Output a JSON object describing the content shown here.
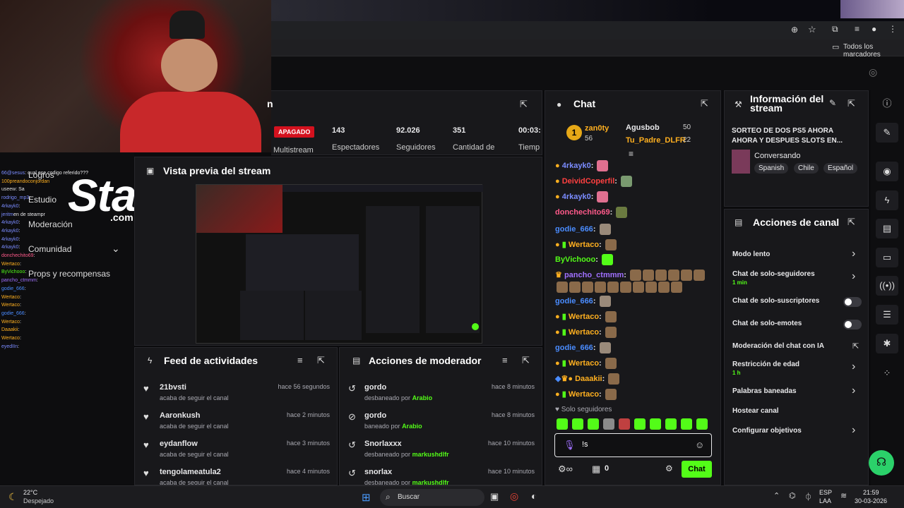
{
  "browser": {
    "bookmarks_label": "Todos los marcadores"
  },
  "overlay": {
    "logo": "Stake",
    "logo_sub": ".com",
    "menu": [
      {
        "label": "Logros"
      },
      {
        "label": "Estudio"
      },
      {
        "label": "Moderación"
      },
      {
        "label": "Comunidad"
      },
      {
        "label": "Props y recompensas"
      }
    ],
    "side_chat": [
      {
        "user": "66@sesus",
        "text": ": cual ese codigo referido???"
      },
      {
        "user": "100preandoconjordan",
        "text": ""
      },
      {
        "user": "useew",
        "text": ": Sa"
      },
      {
        "user": "rodrigo_mp3",
        "text": ":"
      },
      {
        "user": "4rkayk0",
        "text": ":"
      },
      {
        "user": "jeritm",
        "text": "en de steampr"
      },
      {
        "user": "4rkayk0",
        "text": ":"
      },
      {
        "user": "4rkayk0",
        "text": ":"
      },
      {
        "user": "4rkayk0",
        "text": ":"
      },
      {
        "user": "4rkayk0",
        "text": ":"
      },
      {
        "user": "donchechito69",
        "text": ":"
      },
      {
        "user": "Wertaco",
        "text": ":"
      },
      {
        "user": "ByVichooo",
        "text": ":"
      },
      {
        "user": "pancho_ctmmm",
        "text": ":"
      },
      {
        "user": "godie_666",
        "text": ":"
      },
      {
        "user": "Wertaco",
        "text": ":"
      },
      {
        "user": "Wertaco",
        "text": ":"
      },
      {
        "user": "godie_666",
        "text": ":"
      },
      {
        "user": "Wertaco",
        "text": ":"
      },
      {
        "user": "Daaakii",
        "text": ":"
      },
      {
        "user": "Wertaco",
        "text": ":"
      },
      {
        "user": "eyedIIn",
        "text": ":"
      }
    ]
  },
  "stats": {
    "status": "APAGADO",
    "multistream": "Multistream",
    "spectators_value": "143",
    "spectators_label": "Espectadores",
    "followers_value": "92.026",
    "followers_label": "Seguidores",
    "amount_value": "351",
    "amount_label": "Cantidad de",
    "time_value": "00:03:",
    "time_label": "Tiemp"
  },
  "preview": {
    "title": "Vista previa del stream"
  },
  "activity": {
    "title": "Feed de actividades",
    "items": [
      {
        "user": "21bvsti",
        "action": "acaba de seguir el canal",
        "time": "hace 56 segundos"
      },
      {
        "user": "Aaronkush",
        "action": "acaba de seguir el canal",
        "time": "hace 2 minutos"
      },
      {
        "user": "eydanflow",
        "action": "acaba de seguir el canal",
        "time": "hace 3 minutos"
      },
      {
        "user": "tengolameatula2",
        "action": "acaba de seguir el canal",
        "time": "hace 4 minutos"
      }
    ]
  },
  "modactions": {
    "title": "Acciones de moderador",
    "items": [
      {
        "user": "gordo",
        "action": "desbaneado por",
        "by": "Arabio",
        "time": "hace 8 minutos"
      },
      {
        "user": "gordo",
        "action": "baneado por",
        "by": "Arabio",
        "time": "hace 8 minutos"
      },
      {
        "user": "Snorlaxxx",
        "action": "desbaneado por",
        "by": "markushdlfr",
        "time": "hace 10 minutos"
      },
      {
        "user": "snorlax",
        "action": "desbaneado por",
        "by": "markushdlfr",
        "time": "hace 10 minutos"
      }
    ]
  },
  "chat": {
    "title": "Chat",
    "top": [
      {
        "rank": "1",
        "user": "zan0ty",
        "amount": "56"
      },
      {
        "rank": "",
        "user": "Agusbob",
        "amount": "50"
      },
      {
        "rank": "",
        "user": "Tu_Padre_DLFR",
        "amount": "22"
      }
    ],
    "messages": [
      {
        "user": "4rkayk0",
        "color": "#7b8cff"
      },
      {
        "user": "DeividCoperfil",
        "color": "#ff4040"
      },
      {
        "user": "4rkayk0",
        "color": "#7b8cff"
      },
      {
        "user": "donchechito69",
        "color": "#ff5a8a"
      },
      {
        "user": "godie_666",
        "color": "#4a8cff"
      },
      {
        "user": "Wertaco",
        "color": "#ffb020"
      },
      {
        "user": "ByVichooo",
        "color": "#53fc18"
      },
      {
        "user": "pancho_ctmmm",
        "color": "#a070ff"
      },
      {
        "user": "godie_666",
        "color": "#4a8cff"
      },
      {
        "user": "Wertaco",
        "color": "#ffb020"
      },
      {
        "user": "Wertaco",
        "color": "#ffb020"
      },
      {
        "user": "godie_666",
        "color": "#4a8cff"
      },
      {
        "user": "Wertaco",
        "color": "#ffb020"
      },
      {
        "user": "Daaakii",
        "color": "#ffb020"
      },
      {
        "user": "Wertaco",
        "color": "#ffb020"
      }
    ],
    "mode_label": "Solo seguidores",
    "input_value": "!s",
    "count_value": "0",
    "send_label": "Chat"
  },
  "info": {
    "title": "Información del stream",
    "stream_title": "SORTEO DE DOS PS5 AHORA AHORA Y DESPUES SLOTS EN...",
    "category": "Conversando",
    "tags": [
      "Spanish",
      "Chile",
      "Español"
    ]
  },
  "channel": {
    "title": "Acciones de canal",
    "items": [
      {
        "label": "Modo lento",
        "sub": ""
      },
      {
        "label": "Chat de solo-seguidores",
        "sub": "1 min"
      },
      {
        "label": "Chat de solo-suscriptores",
        "sub": ""
      },
      {
        "label": "Chat de solo-emotes",
        "sub": ""
      },
      {
        "label": "Moderación del chat con IA",
        "sub": ""
      },
      {
        "label": "Restricción de edad",
        "sub": "1 h"
      },
      {
        "label": "Palabras baneadas",
        "sub": ""
      },
      {
        "label": "Hostear canal",
        "sub": ""
      },
      {
        "label": "Configurar objetivos",
        "sub": ""
      }
    ]
  },
  "taskbar": {
    "temp": "22°C",
    "weather": "Despejado",
    "search": "Buscar",
    "lang": "ESP",
    "lang_sub": "LAA",
    "time": "21:59",
    "date": "30-03-2026"
  },
  "colors": {
    "accent": "#53fc18",
    "danger": "#d4111e",
    "panel": "#18181b"
  }
}
